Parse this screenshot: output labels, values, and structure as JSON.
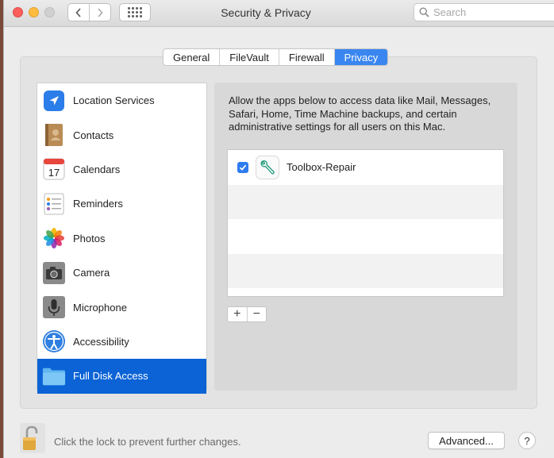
{
  "window": {
    "title": "Security & Privacy",
    "search_placeholder": "Search"
  },
  "tabs": [
    {
      "label": "General",
      "active": false
    },
    {
      "label": "FileVault",
      "active": false
    },
    {
      "label": "Firewall",
      "active": false
    },
    {
      "label": "Privacy",
      "active": true
    }
  ],
  "categories": [
    {
      "label": "Location Services",
      "icon": "location-arrow-icon"
    },
    {
      "label": "Contacts",
      "icon": "contacts-book-icon"
    },
    {
      "label": "Calendars",
      "icon": "calendar-icon",
      "icon_text": "17"
    },
    {
      "label": "Reminders",
      "icon": "reminders-list-icon"
    },
    {
      "label": "Photos",
      "icon": "photos-flower-icon"
    },
    {
      "label": "Camera",
      "icon": "camera-icon"
    },
    {
      "label": "Microphone",
      "icon": "microphone-icon"
    },
    {
      "label": "Accessibility",
      "icon": "accessibility-person-icon"
    },
    {
      "label": "Full Disk Access",
      "icon": "folder-icon",
      "selected": true
    }
  ],
  "detail": {
    "description": "Allow the apps below to access data like Mail, Messages, Safari, Home, Time Machine backups, and certain administrative settings for all users on this Mac.",
    "apps": [
      {
        "name": "Toolbox-Repair",
        "checked": true,
        "icon": "wrench-icon"
      }
    ],
    "add_label": "+",
    "remove_label": "−"
  },
  "footer": {
    "lock_text": "Click the lock to prevent further changes.",
    "advanced_label": "Advanced...",
    "help_label": "?"
  },
  "colors": {
    "accent": "#3a86f0",
    "selection": "#0b63d6"
  }
}
